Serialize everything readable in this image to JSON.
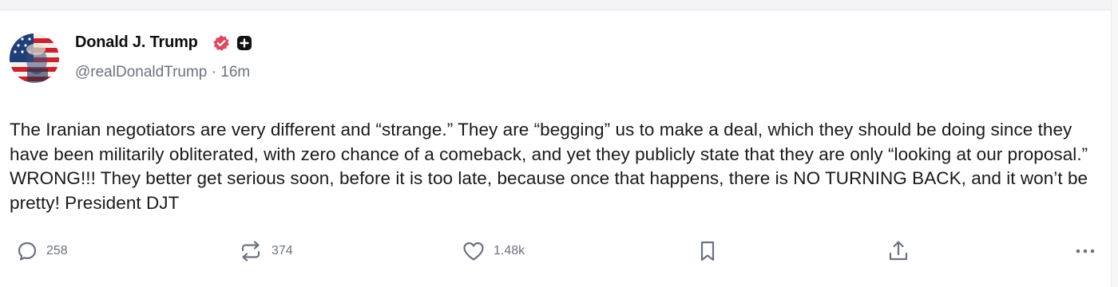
{
  "post": {
    "author_name": "Donald J. Trump",
    "handle": "@realDonaldTrump",
    "separator": "·",
    "time_ago": "16m",
    "text": "The Iranian negotiators are very different and “strange.” They are “begging” us to make a deal, which they should be doing since they have been militarily obliterated, with zero chance of a comeback, and yet they publicly state that they are only “looking at our proposal.” WRONG!!! They better get serious soon, before it is too late, because once that happens, there is NO TURNING BACK, and it won’t be pretty! President DJT",
    "verified_badge_color": "#e0485e",
    "avatar_colors": [
      "#1f3f7a",
      "#c9232e",
      "#f5f0ea"
    ]
  },
  "actions": {
    "reply": {
      "icon": "reply-icon",
      "count": "258"
    },
    "repost": {
      "icon": "repost-icon",
      "count": "374"
    },
    "like": {
      "icon": "heart-icon",
      "count": "1.48k"
    },
    "bookmark": {
      "icon": "bookmark-icon"
    },
    "share": {
      "icon": "share-icon"
    },
    "more": {
      "icon": "more-icon"
    }
  }
}
